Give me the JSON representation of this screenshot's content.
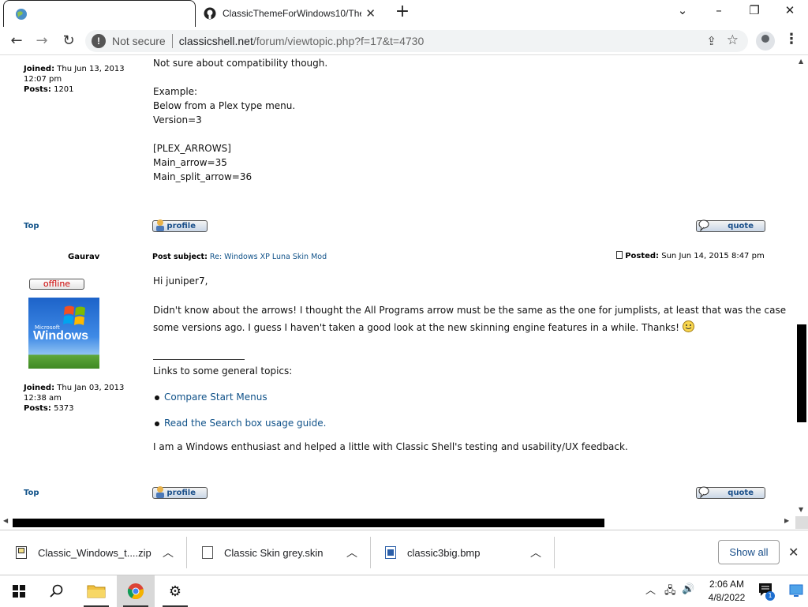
{
  "browser": {
    "tabs": [
      {
        "title": ""
      },
      {
        "title": "ClassicThemeForWindows10/The"
      }
    ],
    "address": {
      "security_label": "Not secure",
      "host": "classicshell.net",
      "path": "/forum/viewtopic.php?f=17&t=4730"
    }
  },
  "post1": {
    "joined_label": "Joined:",
    "joined_value": "Thu Jun 13, 2013",
    "joined_time": "12:07 pm",
    "posts_label": "Posts:",
    "posts_value": "1201",
    "lines": [
      "Not sure about compatibility though.",
      "",
      "Example:",
      "Below from a Plex type menu.",
      "Version=3",
      "",
      "[PLEX_ARROWS]",
      "Main_arrow=35",
      "Main_split_arrow=36"
    ],
    "top_link": "Top",
    "profile_label": "profile",
    "quote_label": "quote"
  },
  "post2": {
    "author": "Gaurav",
    "status": "offline",
    "avatar_ms": "Microsoft",
    "avatar_text": "Windows",
    "subject_label": "Post subject:",
    "subject": "Re: Windows XP Luna Skin Mod",
    "posted_label": "Posted:",
    "posted_value": "Sun Jun 14, 2015 8:47 pm",
    "greeting": "Hi juniper7,",
    "body_line1": "Didn't know about the arrows! I thought the All Programs arrow must be the same as the one for jumplists, at least that was the case",
    "body_line2": "some versions ago. I guess I haven't taken a good look at the new skinning engine features in a while. Thanks!",
    "sig_header": "Links to some general topics:",
    "sig_links": [
      "Compare Start Menus",
      "Read the Search box usage guide."
    ],
    "sig_footer": "I am a Windows enthusiast and helped a little with Classic Shell's testing and usability/UX feedback.",
    "joined_label": "Joined:",
    "joined_value": "Thu Jan 03, 2013",
    "joined_time": "12:38 am",
    "posts_label": "Posts:",
    "posts_value": "5373",
    "top_link": "Top",
    "profile_label": "profile",
    "quote_label": "quote"
  },
  "downloads": [
    {
      "name": "Classic_Windows_t....zip",
      "icon": "zip-file-icon"
    },
    {
      "name": "Classic Skin grey.skin",
      "icon": "file-icon"
    },
    {
      "name": "classic3big.bmp",
      "icon": "image-file-icon"
    }
  ],
  "download_bar": {
    "show_all": "Show all"
  },
  "taskbar": {
    "time": "2:06 AM",
    "date": "4/8/2022",
    "notification_count": "1"
  }
}
